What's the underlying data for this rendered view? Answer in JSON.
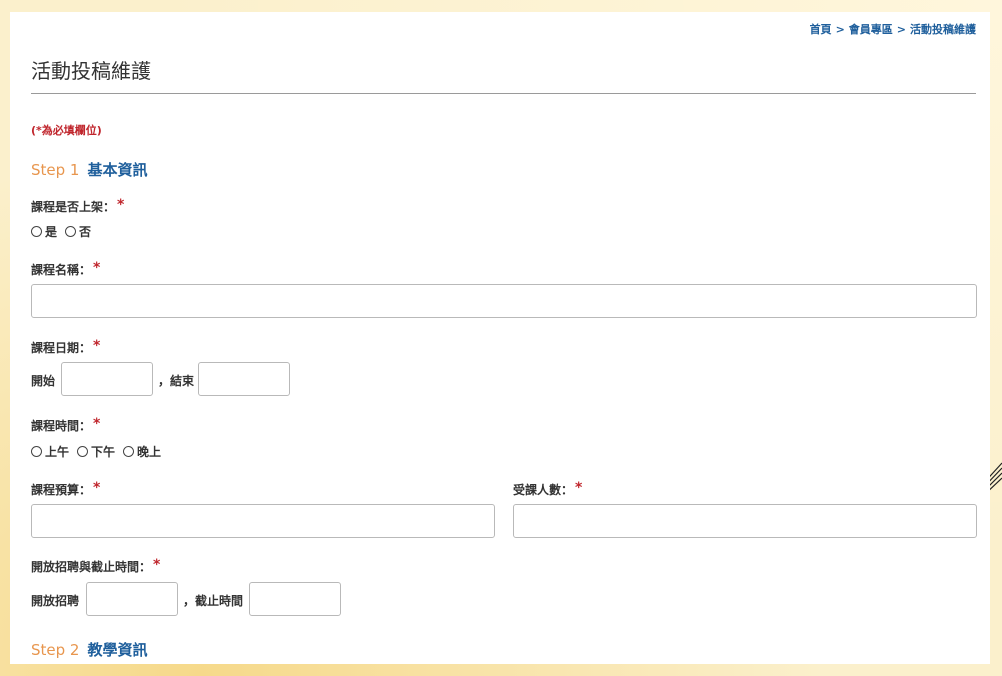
{
  "breadcrumb": {
    "items": [
      "首頁",
      "會員專區",
      "活動投稿維護"
    ],
    "separator": ">"
  },
  "page": {
    "title": "活動投稿維護",
    "required_note": "(*為必填欄位)"
  },
  "colors": {
    "accent_blue": "#1f5f9c",
    "step_orange": "#e8964e",
    "required_red": "#c0262d",
    "background": "#fbf0cc"
  },
  "step1": {
    "number": "Step 1",
    "name": "基本資訊",
    "published": {
      "label": "課程是否上架：",
      "options": [
        "是",
        "否"
      ]
    },
    "course_name": {
      "label": "課程名稱：",
      "value": "",
      "placeholder": ""
    },
    "course_date": {
      "label": "課程日期：",
      "start_label": "開始",
      "end_label": "，結束",
      "start_value": "",
      "end_value": ""
    },
    "course_time": {
      "label": "課程時間：",
      "options": [
        "上午",
        "下午",
        "晚上"
      ]
    },
    "budget": {
      "label": "課程預算：",
      "value": ""
    },
    "attendees": {
      "label": "受課人數：",
      "value": ""
    },
    "recruit": {
      "label": "開放招聘與截止時間：",
      "open_label": "開放招聘",
      "deadline_label": "，截止時間",
      "open_value": "",
      "deadline_value": ""
    }
  },
  "step2": {
    "number": "Step 2",
    "name": "教學資訊"
  },
  "required_mark": "*"
}
